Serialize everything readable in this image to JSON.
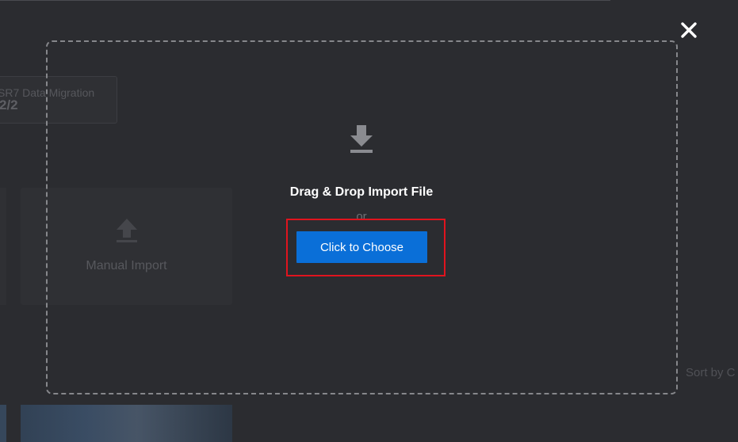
{
  "background": {
    "card": {
      "label": "SR7 Data Migration",
      "value": "2/2"
    },
    "tile": {
      "label": "Manual Import",
      "icon": "upload-icon"
    },
    "sort_label": "Sort by C"
  },
  "dialog": {
    "close_icon": "close-icon",
    "dropzone": {
      "icon": "download-icon",
      "title": "Drag & Drop Import File",
      "or_text": "or",
      "choose_button": "Click to Choose"
    }
  },
  "colors": {
    "background": "#2b2c30",
    "button": "#0a6fd8",
    "highlight": "#e0141e",
    "dash": "#86878b"
  }
}
